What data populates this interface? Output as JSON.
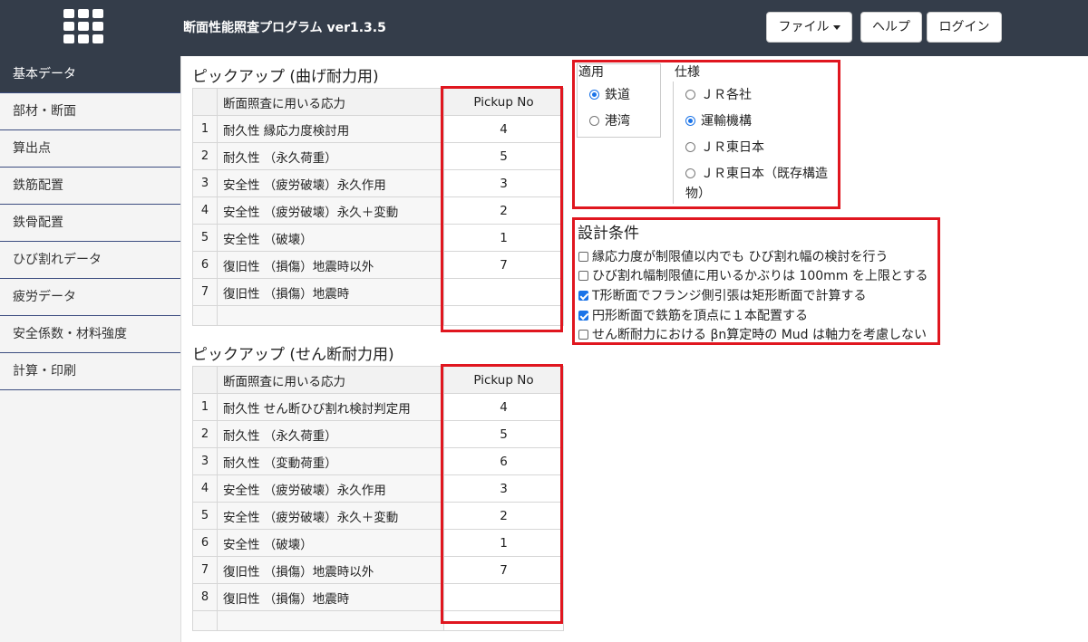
{
  "header": {
    "title": "断面性能照査プログラム ver1.3.5",
    "file_button": "ファイル",
    "help_button": "ヘルプ",
    "login_button": "ログイン",
    "bg_color": "#343d4a"
  },
  "sidebar": {
    "items": [
      {
        "label": "基本データ",
        "active": true
      },
      {
        "label": "部材・断面"
      },
      {
        "label": "算出点"
      },
      {
        "label": "鉄筋配置"
      },
      {
        "label": "鉄骨配置"
      },
      {
        "label": "ひび割れデータ"
      },
      {
        "label": "疲労データ"
      },
      {
        "label": "安全係数・材料強度"
      },
      {
        "label": "計算・印刷"
      }
    ]
  },
  "bending": {
    "title": "ピックアップ (曲げ耐力用)",
    "col_stress": "断面照査に用いる応力",
    "col_pickup": "Pickup No",
    "rows": [
      {
        "n": "1",
        "label": "耐久性 縁応力度検討用",
        "value": "4"
      },
      {
        "n": "2",
        "label": "耐久性 （永久荷重）",
        "value": "5"
      },
      {
        "n": "3",
        "label": "安全性 （疲労破壊）永久作用",
        "value": "3"
      },
      {
        "n": "4",
        "label": "安全性 （疲労破壊）永久＋変動",
        "value": "2"
      },
      {
        "n": "5",
        "label": "安全性 （破壊）",
        "value": "1"
      },
      {
        "n": "6",
        "label": "復旧性 （損傷）地震時以外",
        "value": "7"
      },
      {
        "n": "7",
        "label": "復旧性 （損傷）地震時",
        "value": ""
      }
    ]
  },
  "shear": {
    "title": "ピックアップ (せん断耐力用)",
    "col_stress": "断面照査に用いる応力",
    "col_pickup": "Pickup No",
    "rows": [
      {
        "n": "1",
        "label": "耐久性 せん断ひび割れ検討判定用",
        "value": "4"
      },
      {
        "n": "2",
        "label": "耐久性 （永久荷重）",
        "value": "5"
      },
      {
        "n": "3",
        "label": "耐久性 （変動荷重）",
        "value": "6"
      },
      {
        "n": "4",
        "label": "安全性 （疲労破壊）永久作用",
        "value": "3"
      },
      {
        "n": "5",
        "label": "安全性 （疲労破壊）永久＋変動",
        "value": "2"
      },
      {
        "n": "6",
        "label": "安全性 （破壊）",
        "value": "1"
      },
      {
        "n": "7",
        "label": "復旧性 （損傷）地震時以外",
        "value": "7"
      },
      {
        "n": "8",
        "label": "復旧性 （損傷）地震時",
        "value": ""
      }
    ]
  },
  "application": {
    "title": "適用",
    "options": [
      {
        "label": "鉄道",
        "selected": true
      },
      {
        "label": "港湾",
        "selected": false
      }
    ]
  },
  "spec": {
    "title": "仕様",
    "options": [
      {
        "label": "ＪＲ各社",
        "selected": false
      },
      {
        "label": "運輸機構",
        "selected": true
      },
      {
        "label": "ＪＲ東日本",
        "selected": false
      },
      {
        "label": "ＪＲ東日本（既存構造",
        "label2": "物）",
        "selected": false
      }
    ]
  },
  "design": {
    "title": "設計条件",
    "conditions": [
      {
        "label": "縁応力度が制限値以内でも ひび割れ幅の検討を行う",
        "checked": false
      },
      {
        "label": "ひび割れ幅制限値に用いるかぶりは 100mm を上限とする",
        "checked": false
      },
      {
        "label": "T形断面でフランジ側引張は矩形断面で計算する",
        "checked": true
      },
      {
        "label": "円形断面で鉄筋を頂点に１本配置する",
        "checked": true
      },
      {
        "label": "せん断耐力における βn算定時の Mud は軸力を考慮しない",
        "checked": false
      }
    ]
  },
  "colors": {
    "highlight": "#e0161f",
    "accent": "#1a73e8"
  }
}
